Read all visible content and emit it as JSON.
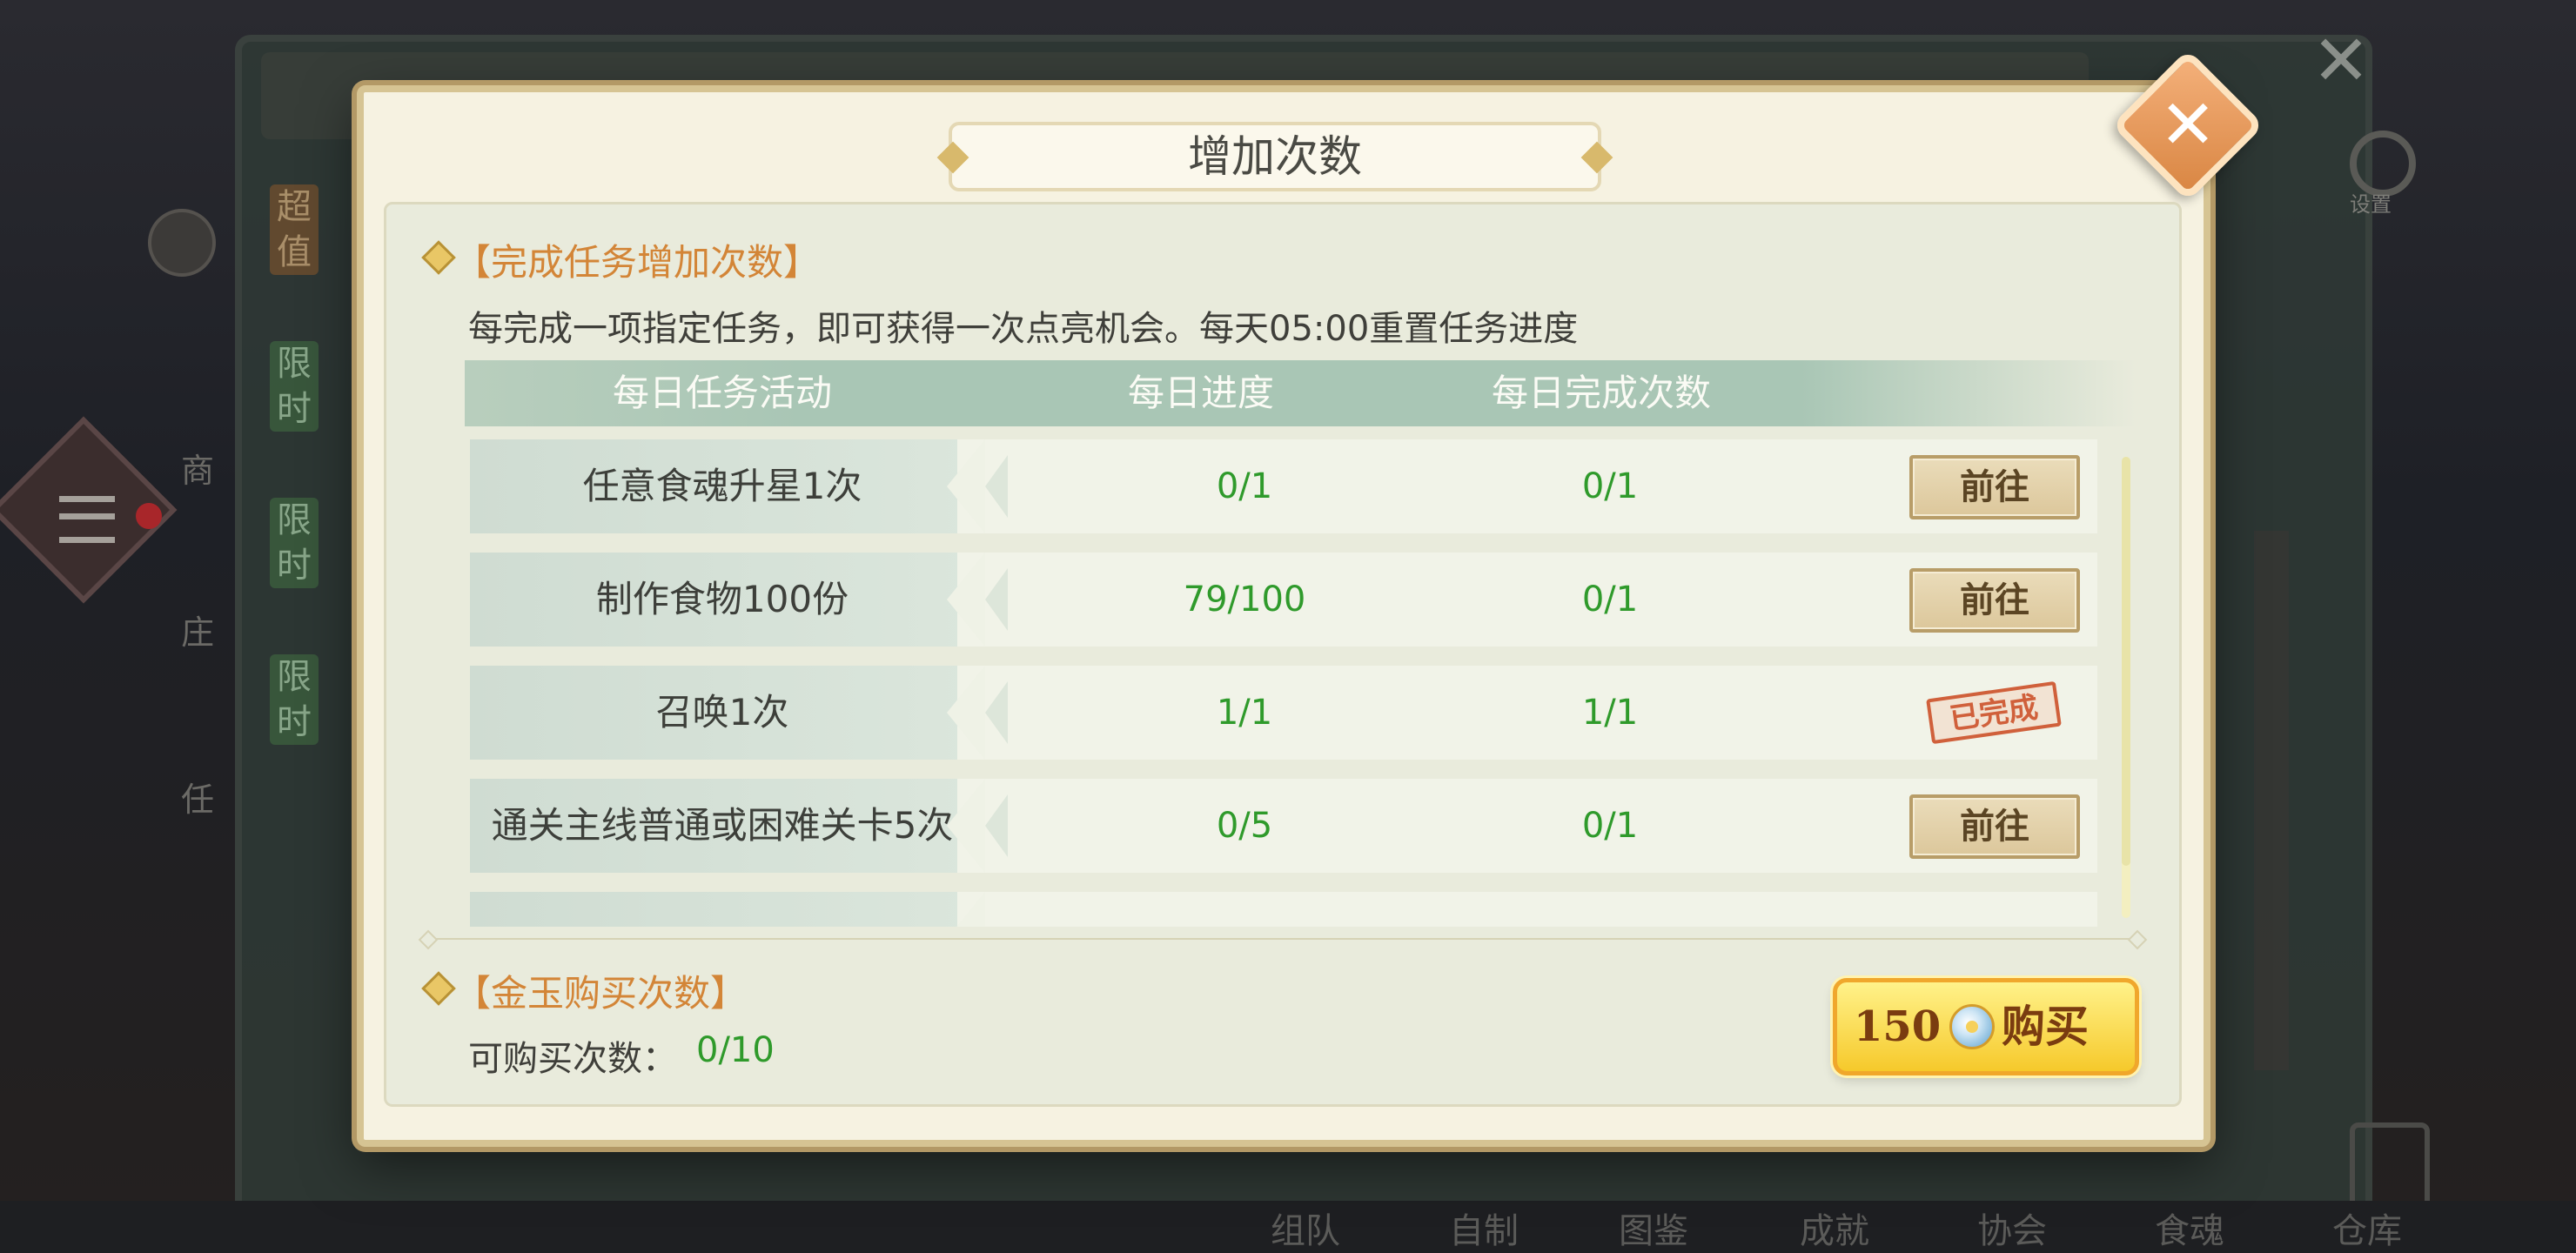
{
  "background": {
    "side_tags": [
      "超值",
      "限时",
      "限时",
      "限时"
    ],
    "side_labels": [
      "商",
      "庄",
      "任"
    ],
    "settings_label": "设置",
    "bottom_nav": [
      "组队",
      "自制",
      "图鉴",
      "成就",
      "协会",
      "食魂",
      "仓库"
    ]
  },
  "dialog": {
    "title": "增加次数",
    "close_icon": "close-icon",
    "task_section": {
      "title": "【完成任务增加次数】",
      "description": "每完成一项指定任务，即可获得一次点亮机会。每天05:00重置任务进度",
      "columns": [
        "每日任务活动",
        "每日进度",
        "每日完成次数"
      ],
      "rows": [
        {
          "task": "任意食魂升星1次",
          "progress": "0/1",
          "completions": "0/1",
          "action": "前往",
          "completed": false
        },
        {
          "task": "制作食物100份",
          "progress": "79/100",
          "completions": "0/1",
          "action": "前往",
          "completed": false
        },
        {
          "task": "召唤1次",
          "progress": "1/1",
          "completions": "1/1",
          "action": "已完成",
          "completed": true
        },
        {
          "task": "通关主线普通或困难关卡5次",
          "progress": "0/5",
          "completions": "0/1",
          "action": "前往",
          "completed": false
        }
      ]
    },
    "purchase_section": {
      "title": "【金玉购买次数】",
      "count_label": "可购买次数：",
      "count_value": "0/10",
      "price": "150",
      "buy_label": "购买",
      "currency_icon": "jade-coin-icon"
    }
  },
  "colors": {
    "accent_orange": "#d38537",
    "progress_green": "#2f9a2b",
    "header_teal": "#a9c6b5",
    "buy_gold": "#f6c92b"
  }
}
